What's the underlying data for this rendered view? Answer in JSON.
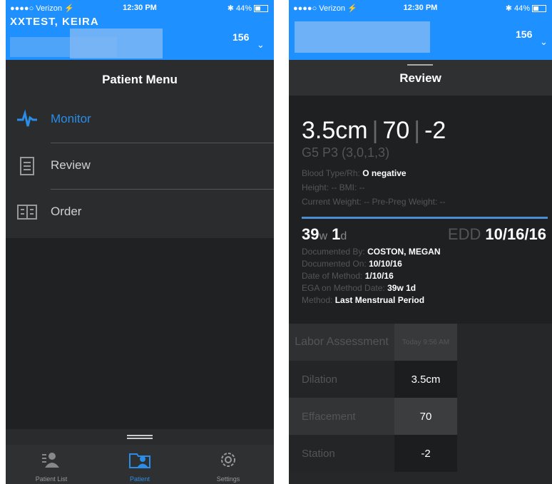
{
  "status": {
    "carrier": "●●●●○ Verizon ⚡",
    "time": "12:30 PM",
    "battery": "✱ 44%"
  },
  "left": {
    "patient_name": "XXTEST, KEIRA",
    "header_number": "156",
    "menu_title": "Patient Menu",
    "menu_items": [
      {
        "label": "Monitor",
        "icon": "monitor-pulse-icon",
        "active": true
      },
      {
        "label": "Review",
        "icon": "clipboard-icon",
        "active": false
      },
      {
        "label": "Order",
        "icon": "order-list-icon",
        "active": false
      }
    ],
    "tabs": [
      {
        "label": "Patient List",
        "icon": "patient-list-icon"
      },
      {
        "label": "Patient",
        "icon": "patient-folder-icon"
      },
      {
        "label": "Settings",
        "icon": "gear-icon"
      }
    ],
    "accent": "#2a8de8"
  },
  "right": {
    "header_number": "156",
    "review_title": "Review",
    "summary": {
      "dilation": "3.5cm",
      "effacement": "70",
      "station": "-2"
    },
    "gp": "G5 P3 (3,0,1,3)",
    "blood_type_label": "Blood Type/Rh:",
    "blood_type_value": "O negative",
    "height_line": "Height: --  BMI: --",
    "weight_line": "Current Weight: --  Pre-Preg Weight: --",
    "ga_weeks": "39",
    "ga_days": "1",
    "edd_label": "EDD",
    "edd_value": "10/16/16",
    "documented_by_label": "Documented By:",
    "documented_by_value": "COSTON, MEGAN",
    "documented_on_label": "Documented On:",
    "documented_on_value": "10/10/16",
    "date_method_label": "Date of Method:",
    "date_method_value": "1/10/16",
    "ega_label": "EGA on Method Date:",
    "ega_value": "39w 1d",
    "method_label": "Method:",
    "method_value": "Last Menstrual Period",
    "labor": {
      "header": "Labor Assessment",
      "col": "Today 9:56 AM",
      "rows": [
        {
          "label": "Dilation",
          "value": "3.5cm"
        },
        {
          "label": "Effacement",
          "value": "70"
        },
        {
          "label": "Station",
          "value": "-2"
        }
      ]
    }
  }
}
